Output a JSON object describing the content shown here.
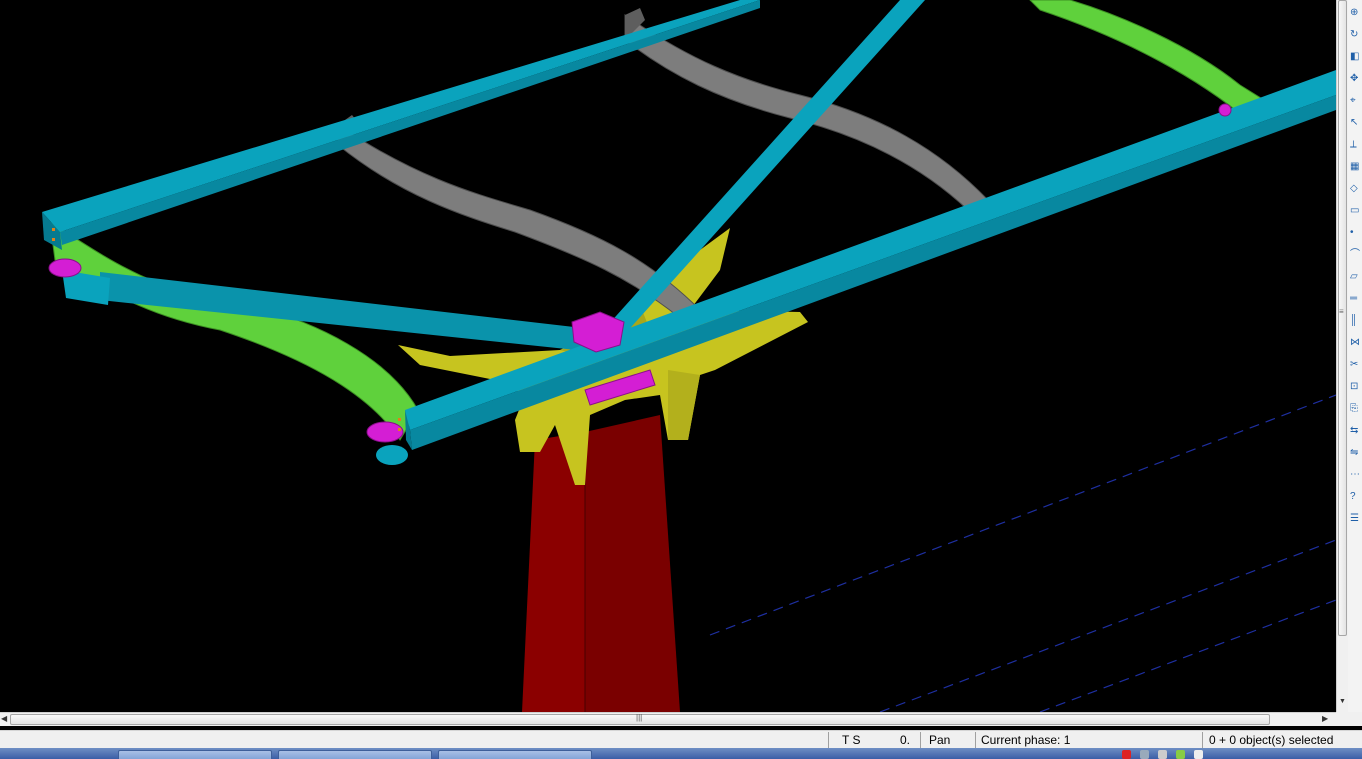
{
  "statusbar": {
    "ts": "T S",
    "zero": "0.",
    "mode": "Pan",
    "phase": "Current phase: 1",
    "selection": "0 + 0 object(s) selected"
  },
  "colors": {
    "background": "#000000",
    "beam_cyan": "#0aa3bd",
    "rib_green": "#5fd13c",
    "rib_gray": "#7d7d7d",
    "plate_magenta": "#d41ed4",
    "gusset_yellow": "#c7c41f",
    "column_red": "#8b0000",
    "grid_blue": "#1e2fa0"
  },
  "icons": {
    "toolbar": [
      "zoom-icon",
      "rotate-icon",
      "view-icon",
      "pan-icon",
      "snap-icon",
      "select-icon",
      "measure-icon",
      "grid-icon",
      "component-icon",
      "part-icon",
      "bolt-icon",
      "weld-icon",
      "plate-icon",
      "beam-icon",
      "column-icon",
      "connection-icon",
      "cut-icon",
      "fitting-icon",
      "copy-icon",
      "move-icon",
      "mirror-icon",
      "array-icon",
      "inquire-icon",
      "report-icon"
    ]
  },
  "taskbar": {
    "tasks": [
      "",
      "",
      ""
    ]
  }
}
